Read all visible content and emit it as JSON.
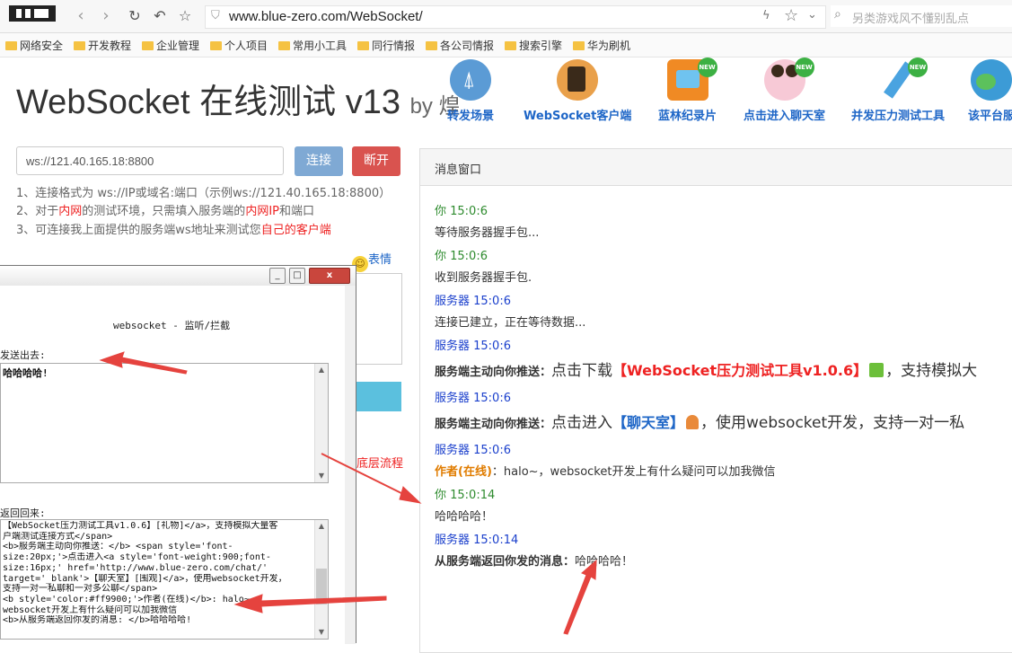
{
  "browser": {
    "url": "www.blue-zero.com/WebSocket/",
    "search_placeholder": "另类游戏风不懂别乱点",
    "bookmarks": [
      "网络安全",
      "开发教程",
      "企业管理",
      "个人项目",
      "常用小工具",
      "同行情报",
      "各公司情报",
      "搜索引擎",
      "华为刷机"
    ]
  },
  "site": {
    "title": "WebSocket 在线测试 v13",
    "by": "by 煌",
    "features": [
      {
        "label": "转发场景",
        "icon": "antenna-icon",
        "color": "#5b9bd5",
        "new": ""
      },
      {
        "label": "WebSocket客户端",
        "icon": "speaker-icon",
        "color": "#e9a04a",
        "new": ""
      },
      {
        "label": "蓝林纪录片",
        "icon": "tv-icon",
        "color": "#f08a24",
        "new": "NEW"
      },
      {
        "label": "点击进入聊天室",
        "icon": "people-icon",
        "color": "#f2a0b8",
        "new": "NEW"
      },
      {
        "label": "并发压力测试工具",
        "icon": "pencil-icon",
        "color": "#4aa3e0",
        "new": "NEW"
      },
      {
        "label": "该平台服",
        "icon": "globe-icon",
        "color": "#3c9bd6",
        "new": ""
      }
    ]
  },
  "form": {
    "ws_address": "ws://121.40.165.18:8800",
    "connect_label": "连接",
    "disconnect_label": "断开",
    "hint1": "1、连接格式为 ws://IP或域名:端口（示例ws://121.40.165.18:8800）",
    "hint2_a": "2、对于",
    "hint2_b": "内网",
    "hint2_c": "的测试环境，只需填入服务端的",
    "hint2_d": "内网IP",
    "hint2_e": "和端口",
    "hint3_a": "3、可连接我上面提供的服务端ws地址来测试您",
    "hint3_b": "自己的客户端",
    "emoji_label": "表情",
    "flow_label": "底层流程"
  },
  "popup": {
    "title": "websocket - 监听/拦截",
    "send_label": "发送出去:",
    "send_value": "哈哈哈哈!",
    "recv_label": "返回回来:",
    "recv_lines": [
      "【WebSocket压力测试工具v1.0.6】[礼物]</a>，支持模拟大量客",
      "户端测试连接方式</span>",
      "<b>服务端主动向你推送：</b> <span style='font-",
      "size:20px;'>点击进入<a style='font-weight:900;font-",
      "size:16px;' href='http://www.blue-zero.com/chat/'",
      "target='_blank'>【聊天室】[围观]</a>，使用websocket开发，",
      "支持一对一私聊和一对多公聊</span>",
      "<b style='color:#ff9900;'>作者(在线)</b>: halo~，",
      "websocket开发上有什么疑问可以加我微信",
      "<b>从服务端返回你发的消息: </b>哈哈哈哈!"
    ],
    "min_icon": "_",
    "max_icon": "□",
    "close_icon": "x"
  },
  "messages": {
    "panel_title": "消息窗口",
    "items": [
      {
        "header": "你 15:0:6",
        "tone": "green",
        "label": "",
        "body": "等待服务器握手包..."
      },
      {
        "header": "你 15:0:6",
        "tone": "green",
        "label": "",
        "body": "收到服务器握手包."
      },
      {
        "header": "服务器 15:0:6",
        "tone": "blue",
        "label": "",
        "body": "连接已建立，正在等待数据..."
      },
      {
        "header": "服务器 15:0:6",
        "tone": "blue",
        "label": "服务端主动向你推送：",
        "big": "点击下载",
        "link": "【WebSocket压力测试工具v1.0.6】",
        "tail": "，支持模拟大"
      },
      {
        "header": "服务器 15:0:6",
        "tone": "blue",
        "label": "服务端主动向你推送：",
        "big": "点击进入",
        "link": "【聊天室】",
        "tail": "，使用websocket开发，支持一对一私"
      },
      {
        "header": "服务器 15:0:6",
        "tone": "blue",
        "label": "作者(在线)",
        "body": "：halo~，websocket开发上有什么疑问可以加我微信"
      },
      {
        "header": "你 15:0:14",
        "tone": "green",
        "label": "",
        "body": "哈哈哈哈！"
      },
      {
        "header": "服务器 15:0:14",
        "tone": "blue",
        "label": "从服务端返回你发的消息：",
        "body": "哈哈哈哈！"
      }
    ]
  },
  "colors": {
    "accent_red": "#e22",
    "arrow": "#e5433e",
    "link_blue": "#1e66c7"
  }
}
